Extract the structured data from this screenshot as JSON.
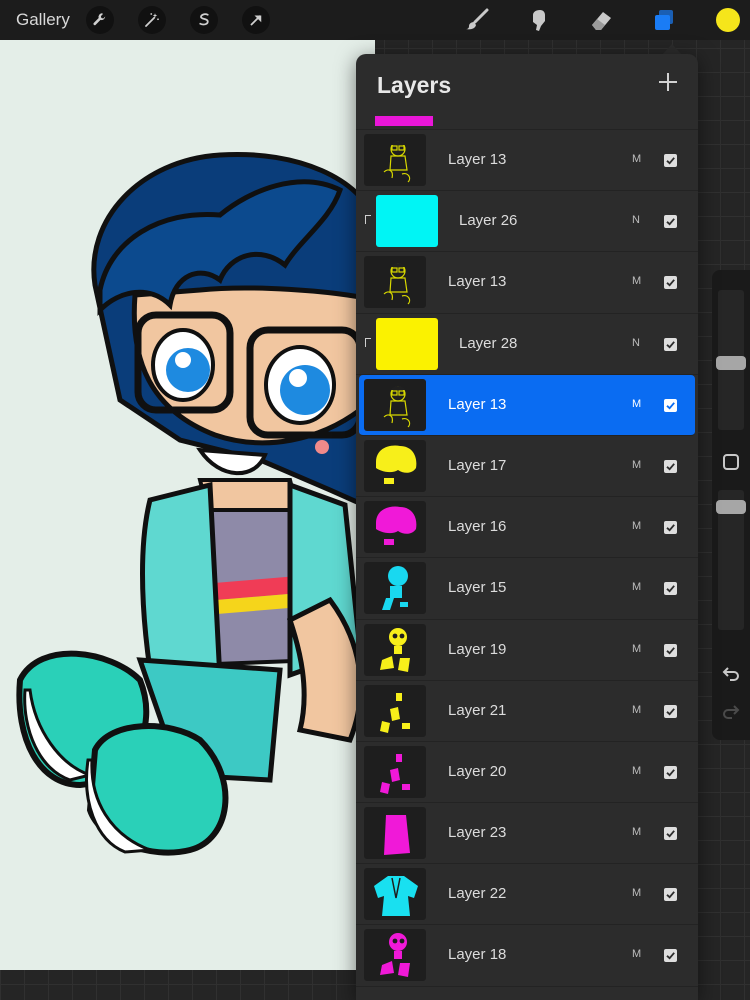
{
  "toolbar": {
    "gallery_label": "Gallery",
    "left_tools": [
      {
        "name": "wrench-icon"
      },
      {
        "name": "magic-wand-icon"
      },
      {
        "name": "selection-icon"
      },
      {
        "name": "transform-arrow-icon"
      }
    ],
    "right_tools": [
      {
        "name": "brush-icon",
        "active": false
      },
      {
        "name": "smudge-icon",
        "active": false
      },
      {
        "name": "eraser-icon",
        "active": false
      },
      {
        "name": "layers-icon",
        "active": true
      }
    ],
    "current_color": "#f5e51b",
    "active_tool_color": "#1a7cf5"
  },
  "layers_panel": {
    "title": "Layers",
    "add_icon": "plus-icon",
    "partial_top_swatch": "#e916d8",
    "layers": [
      {
        "name": "Layer 13",
        "blend": "M",
        "visible": true,
        "clipped": false,
        "selected": false,
        "thumb": "line-art",
        "color": "#d8d800"
      },
      {
        "name": "Layer 26",
        "blend": "N",
        "visible": true,
        "clipped": true,
        "selected": false,
        "thumb": "solid",
        "color": "#00f5f5"
      },
      {
        "name": "Layer 13",
        "blend": "M",
        "visible": true,
        "clipped": false,
        "selected": false,
        "thumb": "line-art",
        "color": "#d8d800"
      },
      {
        "name": "Layer 28",
        "blend": "N",
        "visible": true,
        "clipped": true,
        "selected": false,
        "thumb": "solid",
        "color": "#fbf200"
      },
      {
        "name": "Layer 13",
        "blend": "M",
        "visible": true,
        "clipped": false,
        "selected": true,
        "thumb": "line-art",
        "color": "#d8d800"
      },
      {
        "name": "Layer 17",
        "blend": "M",
        "visible": true,
        "clipped": false,
        "selected": false,
        "thumb": "head",
        "color": "#f7ef1a"
      },
      {
        "name": "Layer 16",
        "blend": "M",
        "visible": true,
        "clipped": false,
        "selected": false,
        "thumb": "head",
        "color": "#f019d8"
      },
      {
        "name": "Layer 15",
        "blend": "M",
        "visible": true,
        "clipped": false,
        "selected": false,
        "thumb": "small-figure",
        "color": "#19d8f0"
      },
      {
        "name": "Layer 19",
        "blend": "M",
        "visible": true,
        "clipped": false,
        "selected": false,
        "thumb": "figure",
        "color": "#f7ef1a"
      },
      {
        "name": "Layer 21",
        "blend": "M",
        "visible": true,
        "clipped": false,
        "selected": false,
        "thumb": "limbs",
        "color": "#f7ef1a"
      },
      {
        "name": "Layer 20",
        "blend": "M",
        "visible": true,
        "clipped": false,
        "selected": false,
        "thumb": "limbs",
        "color": "#f019d8"
      },
      {
        "name": "Layer 23",
        "blend": "M",
        "visible": true,
        "clipped": false,
        "selected": false,
        "thumb": "torso",
        "color": "#f019d8"
      },
      {
        "name": "Layer 22",
        "blend": "M",
        "visible": true,
        "clipped": false,
        "selected": false,
        "thumb": "shirt",
        "color": "#19e0f0"
      },
      {
        "name": "Layer 18",
        "blend": "M",
        "visible": true,
        "clipped": false,
        "selected": false,
        "thumb": "figure",
        "color": "#f019d8"
      }
    ]
  },
  "sidebar": {
    "modify_icon": "square-modify-icon",
    "undo_icon": "undo-arrow-icon",
    "redo_icon": "redo-arrow-icon"
  },
  "canvas": {
    "background": "#e4eee8"
  }
}
